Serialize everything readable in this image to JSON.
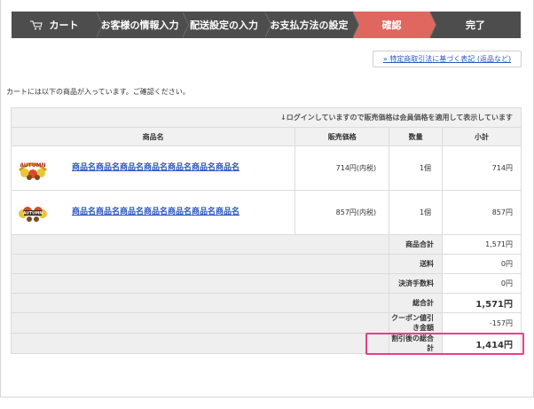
{
  "steps": [
    {
      "label": "カート",
      "active": false
    },
    {
      "label": "お客様の情報入力",
      "active": false
    },
    {
      "label": "配送設定の入力",
      "active": false
    },
    {
      "label": "お支払方法の設定",
      "active": false
    },
    {
      "label": "確認",
      "active": true
    },
    {
      "label": "完了",
      "active": false
    }
  ],
  "legal_link": "» 特定商取引法に基づく表記 (返品など)",
  "intro": "カートには以下の商品が入っています。ご確認ください。",
  "table": {
    "notice": "↓ログインしていますので販売価格は会員価格を適用して表示しています",
    "headers": {
      "name": "商品名",
      "price": "販売価格",
      "qty": "数量",
      "subtotal": "小計"
    },
    "items": [
      {
        "name": "商品名商品名商品名商品名商品名商品名商品名",
        "price": "714円(内税)",
        "qty": "1個",
        "subtotal": "714円",
        "thumb_text": "AUTUMN"
      },
      {
        "name": "商品名商品名商品名商品名商品名商品名商品名",
        "price": "857円(内税)",
        "qty": "1個",
        "subtotal": "857円",
        "thumb_text": "AUTUMN"
      }
    ],
    "summary": [
      {
        "label": "商品合計",
        "value": "1,571円",
        "bold": false
      },
      {
        "label": "送料",
        "value": "0円",
        "bold": false
      },
      {
        "label": "決済手数料",
        "value": "0円",
        "bold": false
      },
      {
        "label": "総合計",
        "value": "1,571円",
        "bold": true
      },
      {
        "label": "クーポン値引き金額",
        "value": "-157円",
        "bold": false
      },
      {
        "label": "割引後の総合計",
        "value": "1,414円",
        "bold": true
      }
    ]
  },
  "colors": {
    "step_active": "#e0675f",
    "step_bg": "#4d4d4d",
    "link": "#2b56c2",
    "highlight": "#ea3f86"
  }
}
